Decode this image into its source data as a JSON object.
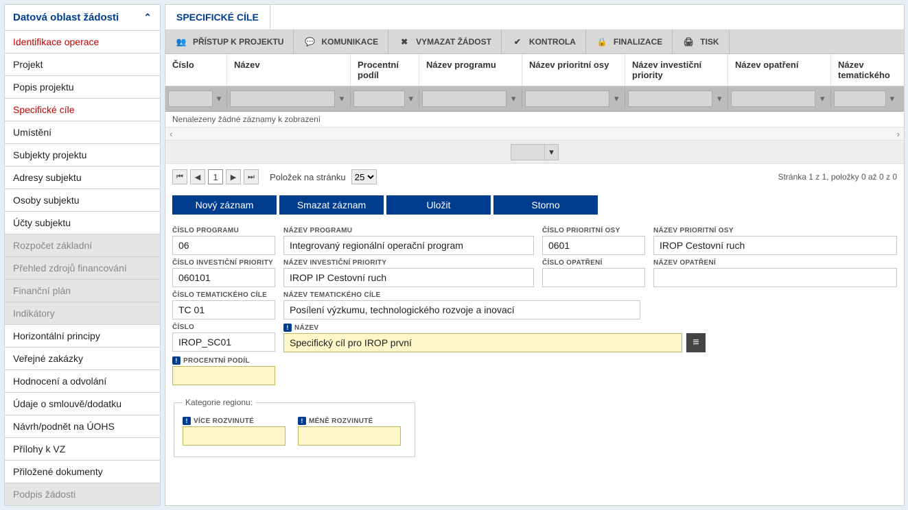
{
  "sidebar": {
    "title": "Datová oblast žádosti",
    "items": [
      {
        "label": "Identifikace operace",
        "state": "active"
      },
      {
        "label": "Projekt",
        "state": ""
      },
      {
        "label": "Popis projektu",
        "state": ""
      },
      {
        "label": "Specifické cíle",
        "state": "active"
      },
      {
        "label": "Umístění",
        "state": ""
      },
      {
        "label": "Subjekty projektu",
        "state": ""
      },
      {
        "label": "Adresy subjektu",
        "state": ""
      },
      {
        "label": "Osoby subjektu",
        "state": ""
      },
      {
        "label": "Účty subjektu",
        "state": ""
      },
      {
        "label": "Rozpočet základní",
        "state": "disabled"
      },
      {
        "label": "Přehled zdrojů financování",
        "state": "disabled"
      },
      {
        "label": "Finanční plán",
        "state": "disabled"
      },
      {
        "label": "Indikátory",
        "state": "disabled"
      },
      {
        "label": "Horizontální principy",
        "state": ""
      },
      {
        "label": "Veřejné zakázky",
        "state": ""
      },
      {
        "label": "Hodnocení a odvolání",
        "state": ""
      },
      {
        "label": "Údaje o smlouvě/dodatku",
        "state": ""
      },
      {
        "label": "Návrh/podnět na ÚOHS",
        "state": ""
      },
      {
        "label": "Přílohy k VZ",
        "state": ""
      },
      {
        "label": "Přiložené dokumenty",
        "state": ""
      },
      {
        "label": "Podpis žádosti",
        "state": "disabled"
      }
    ]
  },
  "tab": {
    "label": "SPECIFICKÉ CÍLE"
  },
  "toolbar": {
    "access": "PŘÍSTUP K PROJEKTU",
    "comm": "KOMUNIKACE",
    "delete": "VYMAZAT ŽÁDOST",
    "check": "KONTROLA",
    "finalize": "FINALIZACE",
    "print": "TISK"
  },
  "grid": {
    "headers": {
      "cislo": "Číslo",
      "nazev": "Název",
      "pp": "Procentní podíl",
      "nprog": "Název programu",
      "npo": "Název prioritní osy",
      "nip": "Název investiční priority",
      "nop": "Název opatření",
      "ntc": "Název tematického"
    },
    "empty": "Nenalezeny žádné záznamy k zobrazení"
  },
  "pager": {
    "page": "1",
    "per_page_label": "Položek na stránku",
    "per_page": "25",
    "info": "Stránka 1 z 1, položky 0 až 0 z 0"
  },
  "actions": {
    "new": "Nový záznam",
    "delete": "Smazat záznam",
    "save": "Uložit",
    "cancel": "Storno"
  },
  "form": {
    "cislo_programu": {
      "label": "ČÍSLO PROGRAMU",
      "value": "06"
    },
    "nazev_programu": {
      "label": "NÁZEV PROGRAMU",
      "value": "Integrovaný regionální operační program"
    },
    "cislo_po": {
      "label": "ČÍSLO PRIORITNÍ OSY",
      "value": "0601"
    },
    "nazev_po": {
      "label": "NÁZEV PRIORITNÍ OSY",
      "value": "IROP Cestovní ruch"
    },
    "cislo_ip": {
      "label": "ČÍSLO INVESTIČNÍ PRIORITY",
      "value": "060101"
    },
    "nazev_ip": {
      "label": "NÁZEV INVESTIČNÍ PRIORITY",
      "value": "IROP IP Cestovní ruch"
    },
    "cislo_op": {
      "label": "ČÍSLO OPATŘENÍ",
      "value": ""
    },
    "nazev_op": {
      "label": "NÁZEV OPATŘENÍ",
      "value": ""
    },
    "cislo_tc": {
      "label": "ČÍSLO TEMATICKÉHO CÍLE",
      "value": "TC 01"
    },
    "nazev_tc": {
      "label": "NÁZEV TEMATICKÉHO CÍLE",
      "value": "Posílení výzkumu, technologického rozvoje a inovací"
    },
    "cislo": {
      "label": "ČÍSLO",
      "value": "IROP_SC01"
    },
    "nazev": {
      "label": "NÁZEV",
      "value": "Specifický cíl pro IROP první"
    },
    "procentni_podil": {
      "label": "PROCENTNÍ PODÍL",
      "value": ""
    },
    "kategorie": {
      "legend": "Kategorie regionu:",
      "vice": "VÍCE ROZVINUTÉ",
      "mene": "MÉNĚ ROZVINUTÉ"
    }
  }
}
